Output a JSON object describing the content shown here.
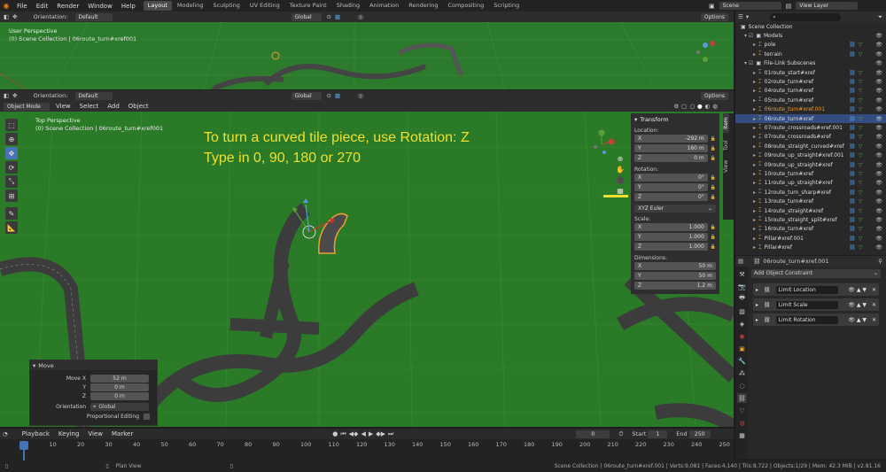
{
  "menu": {
    "file": "File",
    "edit": "Edit",
    "render": "Render",
    "window": "Window",
    "help": "Help"
  },
  "workspaces": [
    "Layout",
    "Modeling",
    "Sculpting",
    "UV Editing",
    "Texture Paint",
    "Shading",
    "Animation",
    "Rendering",
    "Compositing",
    "Scripting"
  ],
  "scene": {
    "name": "Scene",
    "view_layer": "View Layer"
  },
  "top_viewport": {
    "orientation_label": "Orientation:",
    "orientation_value": "Default",
    "transform_orientation": "Global",
    "options": "Options",
    "view_name": "User Perspective",
    "collection_info": "(0) Scene Collection | 06route_turn#xref001"
  },
  "main_viewport": {
    "orientation_label": "Orientation:",
    "orientation_value": "Default",
    "transform_orientation": "Global",
    "options": "Options",
    "mode": "Object Mode",
    "menus": [
      "View",
      "Select",
      "Add",
      "Object"
    ],
    "view_name": "Top Perspective",
    "collection_info": "(0) Scene Collection | 06route_turn#xref001",
    "annotation_line1": "To turn a curved tile piece, use Rotation: Z",
    "annotation_line2": "Type in 0, 90, 180 or 270"
  },
  "sidebar_tabs": [
    "Item",
    "Tool",
    "View"
  ],
  "transform_panel": {
    "title": "Transform",
    "location_label": "Location:",
    "location": [
      {
        "axis": "X",
        "value": "-292 m"
      },
      {
        "axis": "Y",
        "value": "160 m"
      },
      {
        "axis": "Z",
        "value": "0 m"
      }
    ],
    "rotation_label": "Rotation:",
    "rotation": [
      {
        "axis": "X",
        "value": "0°"
      },
      {
        "axis": "Y",
        "value": "0°"
      },
      {
        "axis": "Z",
        "value": "0°"
      }
    ],
    "rotation_mode": "XYZ Euler",
    "scale_label": "Scale:",
    "scale": [
      {
        "axis": "X",
        "value": "1.000"
      },
      {
        "axis": "Y",
        "value": "1.000"
      },
      {
        "axis": "Z",
        "value": "1.000"
      }
    ],
    "dimensions_label": "Dimensions:",
    "dimensions": [
      {
        "axis": "X",
        "value": "50 m"
      },
      {
        "axis": "Y",
        "value": "50 m"
      },
      {
        "axis": "Z",
        "value": "1.2 m"
      }
    ]
  },
  "move_panel": {
    "title": "Move",
    "move_x_label": "Move X",
    "move_x": "52 m",
    "y_label": "Y",
    "y": "0 m",
    "z_label": "Z",
    "z": "0 m",
    "orientation_label": "Orientation",
    "orientation": "Global",
    "proportional_label": "Proportional Editing"
  },
  "outliner": {
    "root": "Scene Collection",
    "items": [
      {
        "name": "Models",
        "indent": 1,
        "type": "collection"
      },
      {
        "name": "pole",
        "indent": 2,
        "type": "object"
      },
      {
        "name": "terrain",
        "indent": 2,
        "type": "object"
      },
      {
        "name": "File-Link Subscenes",
        "indent": 1,
        "type": "collection"
      },
      {
        "name": "01route_start#xref",
        "indent": 2,
        "type": "object"
      },
      {
        "name": "02route_turn#xref",
        "indent": 2,
        "type": "object"
      },
      {
        "name": "04route_turn#xref",
        "indent": 2,
        "type": "object"
      },
      {
        "name": "05route_turn#xref",
        "indent": 2,
        "type": "object"
      },
      {
        "name": "06route_turn#xref.001",
        "indent": 2,
        "type": "object",
        "state": "orange"
      },
      {
        "name": "06route_turn#xref",
        "indent": 2,
        "type": "object",
        "state": "selected"
      },
      {
        "name": "07route_crossroads#xref.001",
        "indent": 2,
        "type": "object"
      },
      {
        "name": "07route_crossroads#xref",
        "indent": 2,
        "type": "object"
      },
      {
        "name": "08route_straight_curved#xref",
        "indent": 2,
        "type": "object"
      },
      {
        "name": "09route_up_straight#xref.001",
        "indent": 2,
        "type": "object"
      },
      {
        "name": "09route_up_straight#xref",
        "indent": 2,
        "type": "object"
      },
      {
        "name": "10route_turn#xref",
        "indent": 2,
        "type": "object"
      },
      {
        "name": "11route_up_straight#xref",
        "indent": 2,
        "type": "object"
      },
      {
        "name": "12route_turn_sharp#xref",
        "indent": 2,
        "type": "object"
      },
      {
        "name": "13route_turn#xref",
        "indent": 2,
        "type": "object"
      },
      {
        "name": "14route_straight#xref",
        "indent": 2,
        "type": "object"
      },
      {
        "name": "15route_straight_split#xref",
        "indent": 2,
        "type": "object"
      },
      {
        "name": "16route_turn#xref",
        "indent": 2,
        "type": "object"
      },
      {
        "name": "Pillar#xref.001",
        "indent": 2,
        "type": "object"
      },
      {
        "name": "Pillar#xref",
        "indent": 2,
        "type": "object"
      }
    ]
  },
  "properties": {
    "object_name": "06route_turn#xref.001",
    "add_constraint": "Add Object Constraint",
    "constraints": [
      "Limit Location",
      "Limit Scale",
      "Limit Rotation"
    ]
  },
  "timeline": {
    "menus": [
      "Playback",
      "Keying",
      "View",
      "Marker"
    ],
    "current_frame": "0",
    "start_label": "Start",
    "start": "1",
    "end_label": "End",
    "end": "250",
    "ticks": [
      "0",
      "10",
      "20",
      "30",
      "40",
      "50",
      "60",
      "70",
      "80",
      "90",
      "100",
      "110",
      "120",
      "130",
      "140",
      "150",
      "160",
      "170",
      "180",
      "190",
      "200",
      "210",
      "220",
      "230",
      "240",
      "250"
    ]
  },
  "statusbar": {
    "hint": "Plan View",
    "info": "Scene Collection | 06route_turn#xref.001 | Verts:9,081 | Faces:4,140 | Tris:8,722 | Objects:1/29 | Mem: 42.3 MiB | v2.81.16"
  }
}
